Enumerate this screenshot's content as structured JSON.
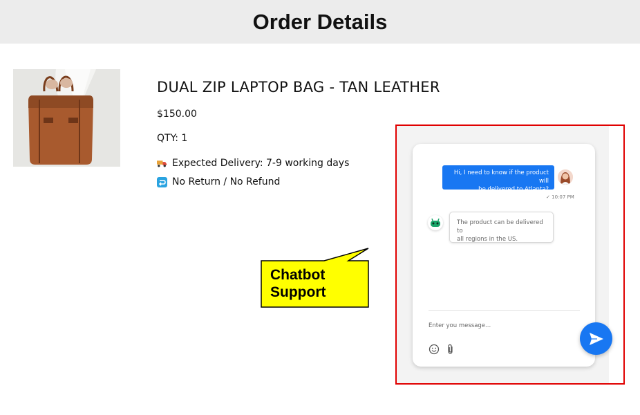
{
  "header": {
    "title": "Order Details"
  },
  "product": {
    "name": "DUAL ZIP LAPTOP BAG - TAN LEATHER",
    "price": "$150.00",
    "qty": "QTY: 1",
    "delivery": "Expected Delivery: 7-9 working days",
    "return_policy": "No Return / No Refund",
    "image_icon": "leather-bag-photo"
  },
  "callout": {
    "line1": "Chatbot",
    "line2": "Support"
  },
  "chat": {
    "messages": [
      {
        "sender": "user",
        "text_line1": "Hi, I need to know if the product will",
        "text_line2": "be delivered to Atlanta?",
        "time": "10:07 PM"
      },
      {
        "sender": "bot",
        "text_line1": "The product can be delivered to",
        "text_line2": "all regions in the US."
      }
    ],
    "input_placeholder": "Enter you message...",
    "send_icon": "send-icon",
    "emoji_icon": "emoji-icon",
    "attach_icon": "paperclip-icon"
  },
  "colors": {
    "accent": "#1877f2",
    "highlight": "#e00000",
    "callout": "#ffff00"
  }
}
